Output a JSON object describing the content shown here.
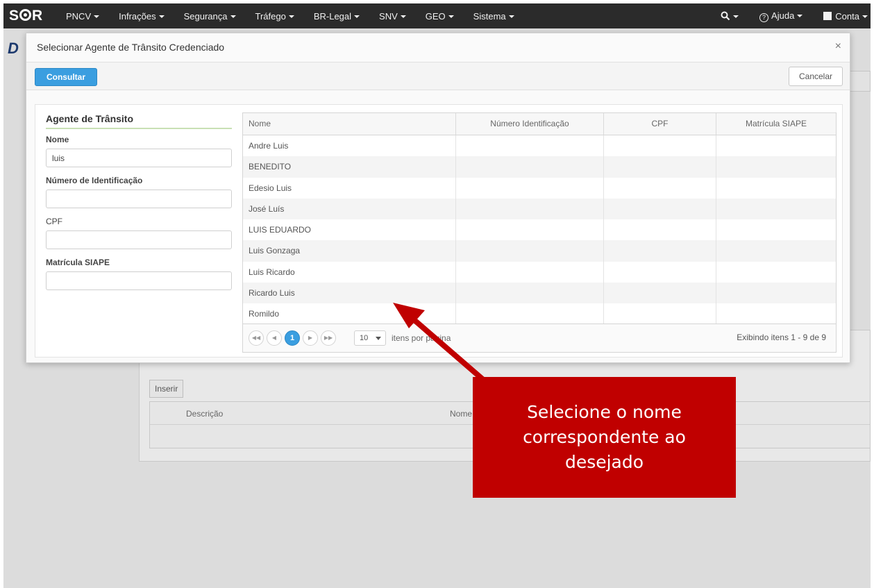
{
  "navbar": {
    "brand": "SIOR",
    "menus": [
      "PNCV",
      "Infrações",
      "Segurança",
      "Tráfego",
      "BR-Legal",
      "SNV",
      "GEO",
      "Sistema"
    ],
    "help": "Ajuda",
    "account": "Conta"
  },
  "background": {
    "logo_letter": "D",
    "insert_label": "Inserir",
    "columns": [
      "Descrição",
      "Nome"
    ]
  },
  "modal": {
    "title": "Selecionar Agente de Trânsito Credenciado",
    "close_glyph": "×",
    "consultar_label": "Consultar",
    "cancelar_label": "Cancelar"
  },
  "form": {
    "title": "Agente de Trânsito",
    "nome_label": "Nome",
    "nome_value": "luis",
    "numero_label": "Número de Identificação",
    "numero_value": "",
    "cpf_label": "CPF",
    "cpf_value": "",
    "matricula_label": "Matrícula SIAPE",
    "matricula_value": ""
  },
  "grid": {
    "headers": [
      "Nome",
      "Número Identificação",
      "CPF",
      "Matrícula SIAPE"
    ],
    "rows": [
      [
        "Andre Luis",
        "",
        "",
        ""
      ],
      [
        "BENEDITO",
        "",
        "",
        ""
      ],
      [
        "Edesio Luis",
        "",
        "",
        ""
      ],
      [
        "José Luís",
        "",
        "",
        ""
      ],
      [
        "LUIS EDUARDO",
        "",
        "",
        ""
      ],
      [
        "Luis Gonzaga",
        "",
        "",
        ""
      ],
      [
        "Luis Ricardo",
        "",
        "",
        ""
      ],
      [
        "Ricardo Luis",
        "",
        "",
        ""
      ],
      [
        "Romildo",
        "",
        "",
        ""
      ]
    ]
  },
  "pager": {
    "current_page": "1",
    "page_size": "10",
    "per_page_label": "itens por página",
    "info": "Exibindo itens 1 - 9 de 9"
  },
  "callout": {
    "lines": [
      "Selecione o nome",
      "correspondente ao",
      "desejado"
    ]
  },
  "colors": {
    "navbar": "#2b2b2b",
    "primary_button": "#3a9ee0",
    "callout": "#c00000"
  }
}
